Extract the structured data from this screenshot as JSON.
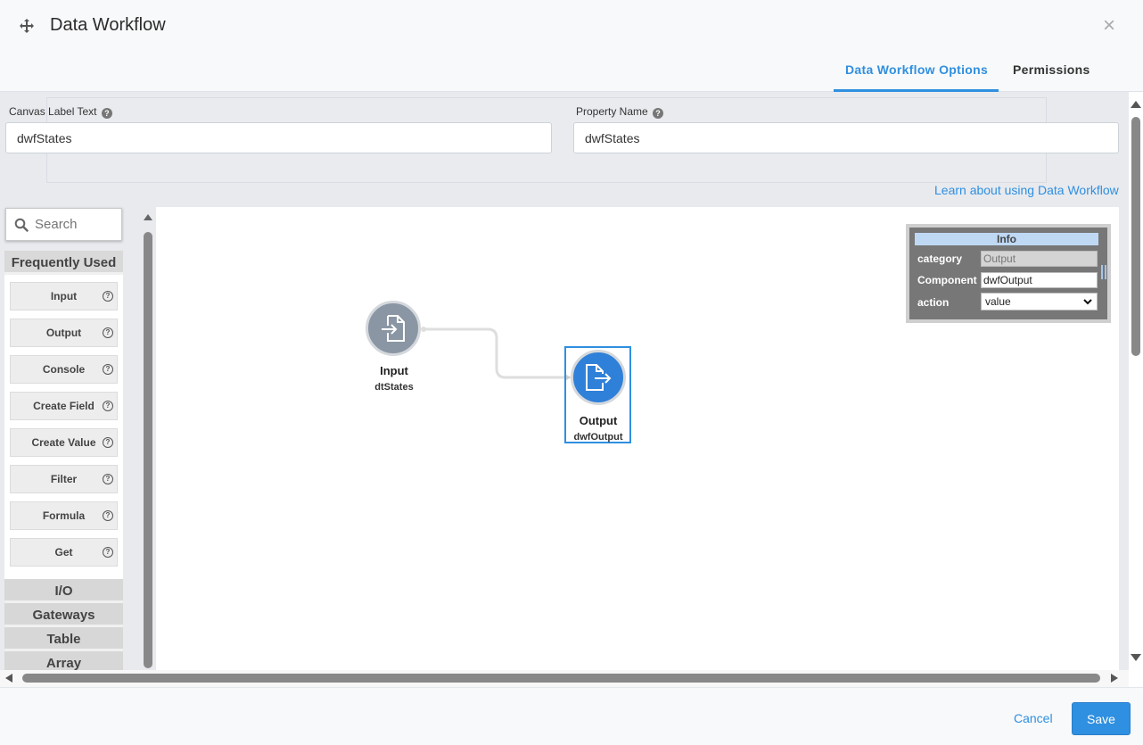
{
  "window": {
    "title": "Data Workflow",
    "close_glyph": "×"
  },
  "tabs": [
    {
      "label": "Data Workflow Options",
      "active": true
    },
    {
      "label": "Permissions",
      "active": false
    }
  ],
  "form": {
    "canvas_label": {
      "label": "Canvas Label Text",
      "value": "dwfStates"
    },
    "property_name": {
      "label": "Property Name",
      "value": "dwfStates"
    },
    "help_glyph": "?",
    "learn_link": "Learn about using Data Workflow"
  },
  "palette": {
    "search_placeholder": "Search",
    "group_open": "Frequently Used",
    "items": [
      "Input",
      "Output",
      "Console",
      "Create Field",
      "Create Value",
      "Filter",
      "Formula",
      "Get"
    ],
    "help_glyph": "?",
    "groups_closed": [
      "I/O",
      "Gateways",
      "Table",
      "Array"
    ]
  },
  "canvas": {
    "nodes": [
      {
        "title": "Input",
        "subtitle": "dtStates",
        "color": "#8a96a3"
      },
      {
        "title": "Output",
        "subtitle": "dwfOutput",
        "color": "#2f80d8",
        "selected": true
      }
    ],
    "info_panel": {
      "title": "Info",
      "rows": [
        {
          "label": "category",
          "value": "Output",
          "disabled": true
        },
        {
          "label": "Component",
          "value": "dwfOutput",
          "disabled": false
        },
        {
          "label": "action",
          "value": "value",
          "type": "select"
        }
      ]
    }
  },
  "footer": {
    "cancel_label": "Cancel",
    "save_label": "Save"
  },
  "colors": {
    "accent": "#2f8fe0",
    "input_node": "#8a96a3",
    "output_node": "#2f80d8"
  }
}
